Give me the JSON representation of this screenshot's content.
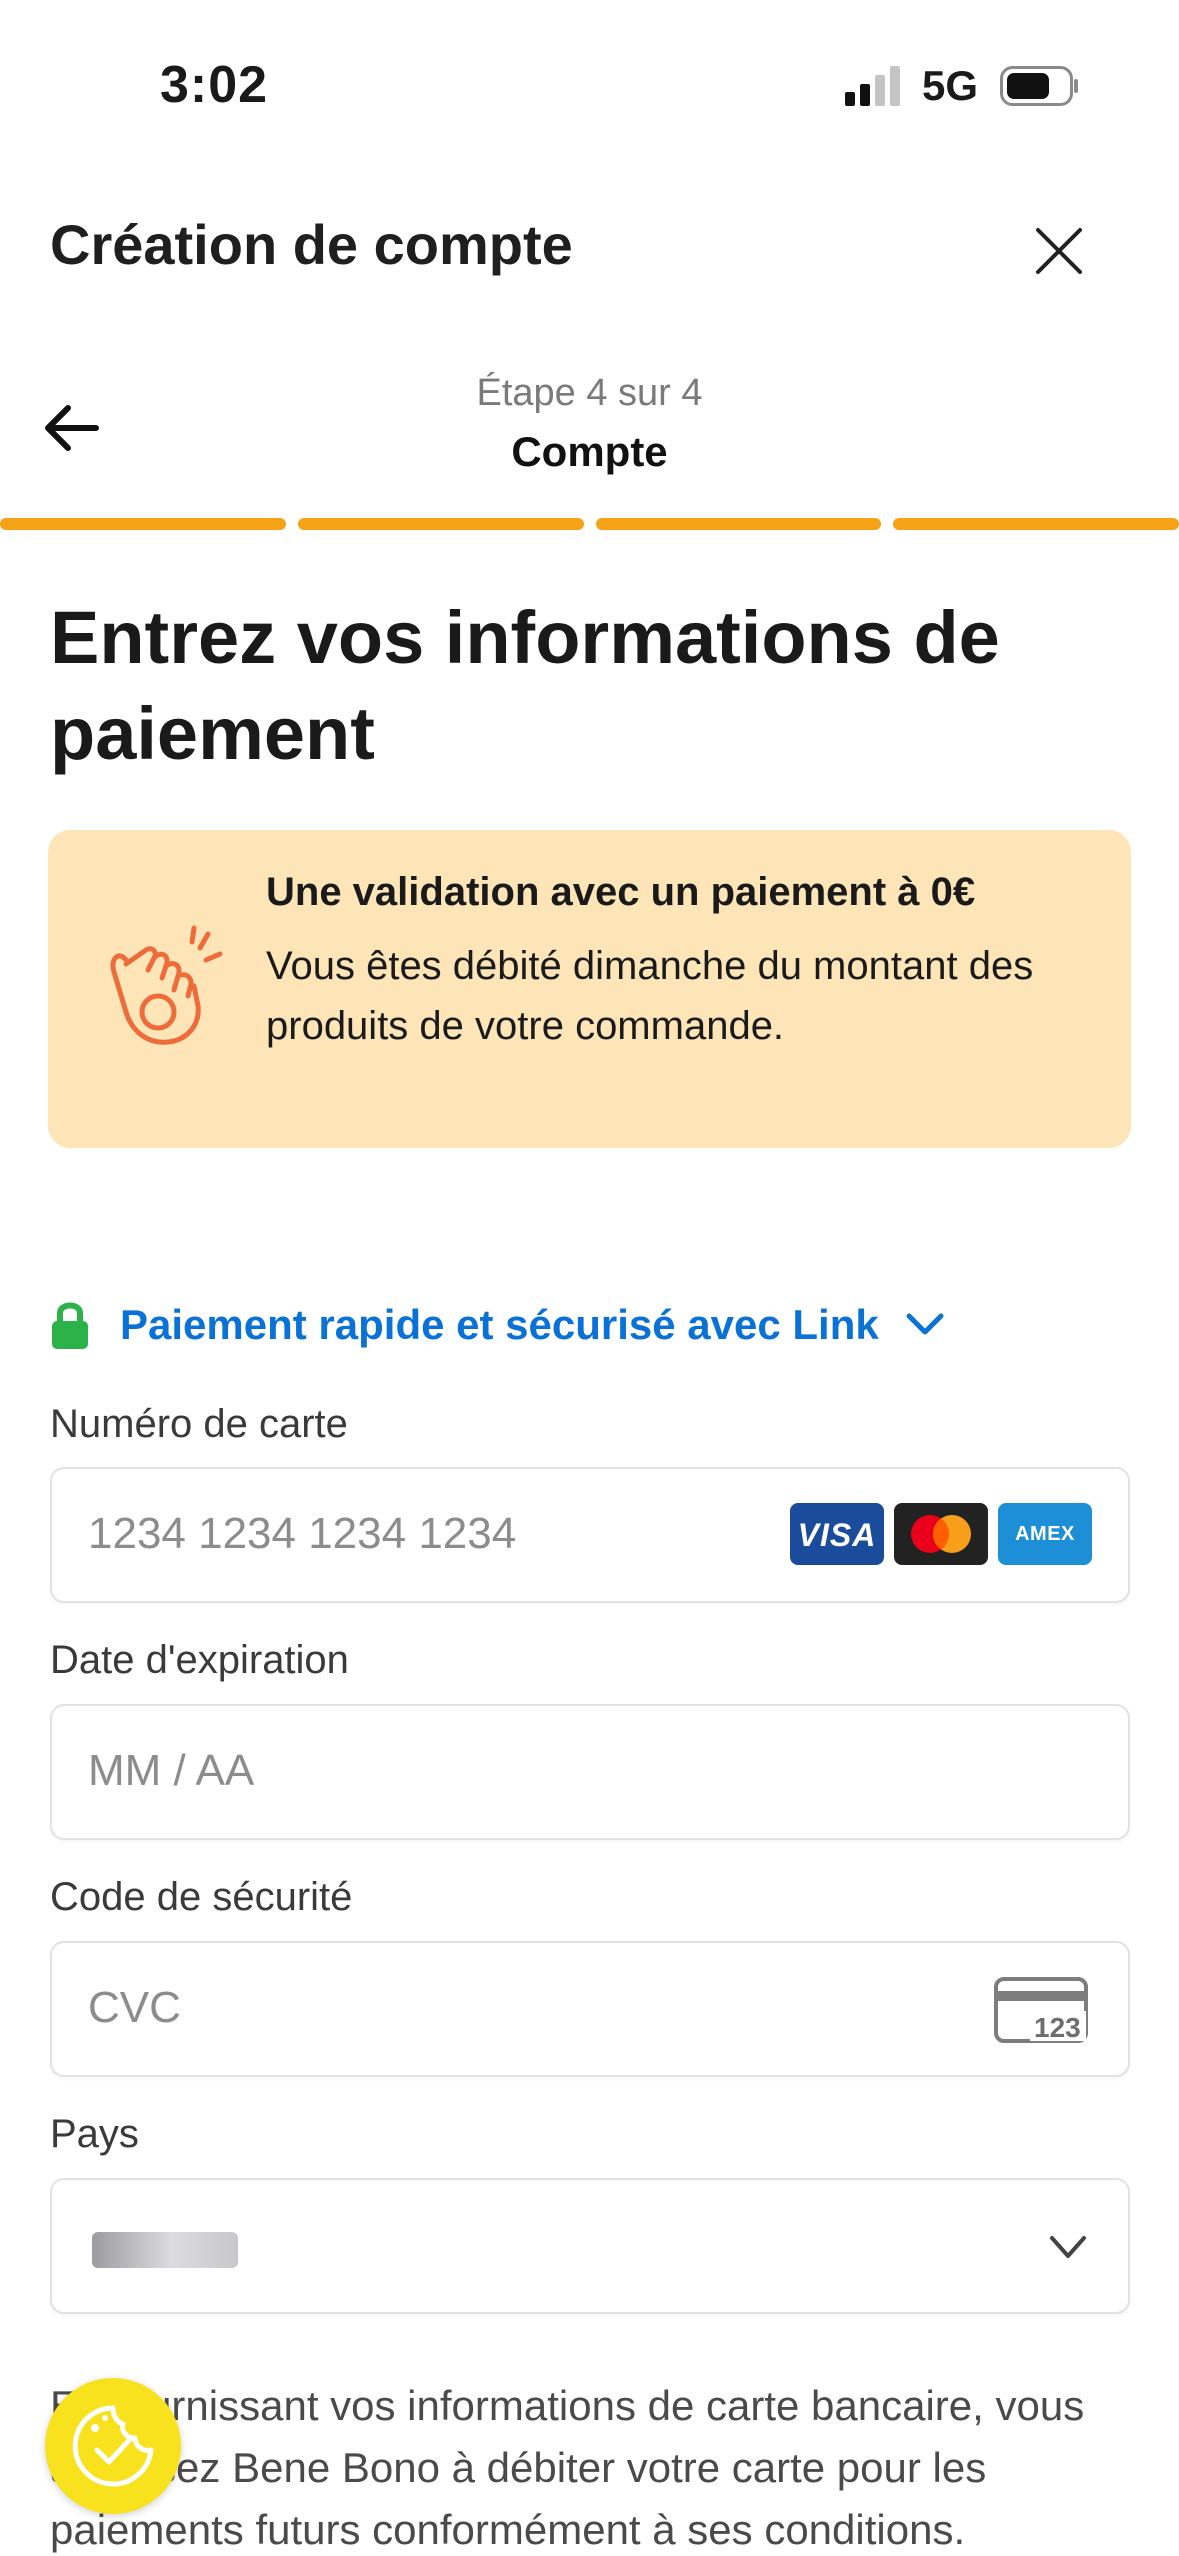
{
  "status_bar": {
    "time": "3:02",
    "network": "5G"
  },
  "header": {
    "title": "Création de compte",
    "step_label": "Étape 4 sur 4",
    "step_name": "Compte"
  },
  "progress": {
    "total_steps": 4,
    "current_step": 4,
    "color": "#f5a216"
  },
  "main_title": "Entrez vos informations de paiement",
  "info_box": {
    "title": "Une validation avec un paiement à 0€",
    "text": "Vous êtes débité dimanche du montant des produits de votre commande."
  },
  "link_row": {
    "text": "Paiement rapide et sécurisé avec Link"
  },
  "form": {
    "card_number": {
      "label": "Numéro de carte",
      "placeholder": "1234 1234 1234 1234",
      "brands": [
        "VISA",
        "Mastercard",
        "AMEX"
      ]
    },
    "expiry": {
      "label": "Date d'expiration",
      "placeholder": "MM / AA"
    },
    "cvc": {
      "label": "Code de sécurité",
      "placeholder": "CVC",
      "icon_text": "123"
    },
    "country": {
      "label": "Pays"
    }
  },
  "legal_text": "En fournissant vos informations de carte bancaire, vous autorisez Bene Bono à débiter votre carte pour les paiements futurs conformément à ses conditions.",
  "colors": {
    "accent": "#f5a216",
    "link": "#0a72d6",
    "info_bg": "#fde5b8",
    "cookie_bg": "#f7e21d",
    "lock": "#2bb34a"
  }
}
